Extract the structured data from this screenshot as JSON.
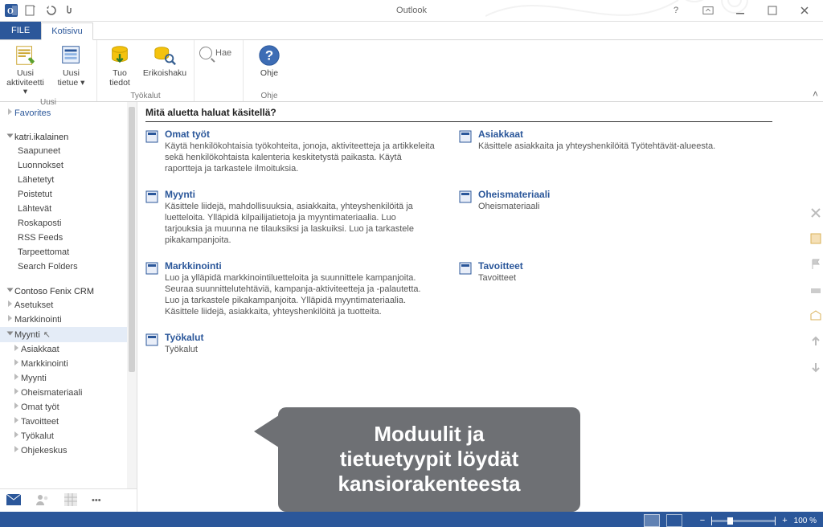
{
  "title": "Outlook",
  "tabs": {
    "file": "FILE",
    "home": "Kotisivu"
  },
  "ribbon": {
    "groups": {
      "uusi": {
        "label": "Uusi",
        "new_activity": "Uusi\naktiviteetti ▾",
        "new_record": "Uusi\ntietue ▾"
      },
      "tyokalut": {
        "label": "Työkalut",
        "import": "Tuo\ntiedot",
        "advfind": "Erikoishaku"
      },
      "search": {
        "label": "Hae"
      },
      "ohje": {
        "label": "Ohje",
        "help": "Ohje"
      }
    }
  },
  "nav": {
    "favorites": "Favorites",
    "account": "katri.ikalainen",
    "folders": [
      "Saapuneet",
      "Luonnokset",
      "Lähetetyt",
      "Poistetut",
      "Lähtevät",
      "Roskaposti",
      "RSS Feeds",
      "Tarpeettomat",
      "Search Folders"
    ],
    "crm_root": "Contoso Fenix CRM",
    "crm_top": [
      "Asetukset",
      "Markkinointi"
    ],
    "crm_sel": "Myynti",
    "crm_children": [
      "Asiakkaat",
      "Markkinointi",
      "Myynti",
      "Oheismateriaali",
      "Omat työt",
      "Tavoitteet",
      "Työkalut",
      "Ohjekeskus"
    ]
  },
  "content": {
    "heading": "Mitä aluetta haluat käsitellä?",
    "tiles": {
      "omat": {
        "t": "Omat työt",
        "d": "Käytä henkilökohtaisia työkohteita, jonoja, aktiviteetteja ja artikkeleita sekä henkilökohtaista kalenteria keskitetystä paikasta. Käytä raportteja ja tarkastele ilmoituksia."
      },
      "asiak": {
        "t": "Asiakkaat",
        "d": "Käsittele asiakkaita ja yhteyshenkilöitä Työtehtävät-alueesta."
      },
      "myynti": {
        "t": "Myynti",
        "d": "Käsittele liidejä, mahdollisuuksia, asiakkaita, yhteyshenkilöitä ja luetteloita. Ylläpidä kilpailijatietoja ja myyntimateriaalia. Luo tarjouksia ja muunna ne tilauksiksi ja laskuiksi. Luo ja tarkastele pikakampanjoita."
      },
      "oheis": {
        "t": "Oheismateriaali",
        "d": "Oheismateriaali"
      },
      "markk": {
        "t": "Markkinointi",
        "d": "Luo ja ylläpidä markkinointiluetteloita ja suunnittele kampanjoita. Seuraa suunnittelutehtäviä, kampanja-aktiviteetteja ja -palautetta. Luo ja tarkastele pikakampanjoita. Ylläpidä myyntimateriaalia. Käsittele liidejä, asiakkaita, yhteyshenkilöitä ja tuotteita."
      },
      "tavo": {
        "t": "Tavoitteet",
        "d": "Tavoitteet"
      },
      "tyok": {
        "t": "Työkalut",
        "d": "Työkalut"
      }
    }
  },
  "callout": {
    "l1": "Moduulit ja",
    "l2": "tietuetyypit löydät",
    "l3": "kansiorakenteesta"
  },
  "status": {
    "zoom": "100 %"
  }
}
